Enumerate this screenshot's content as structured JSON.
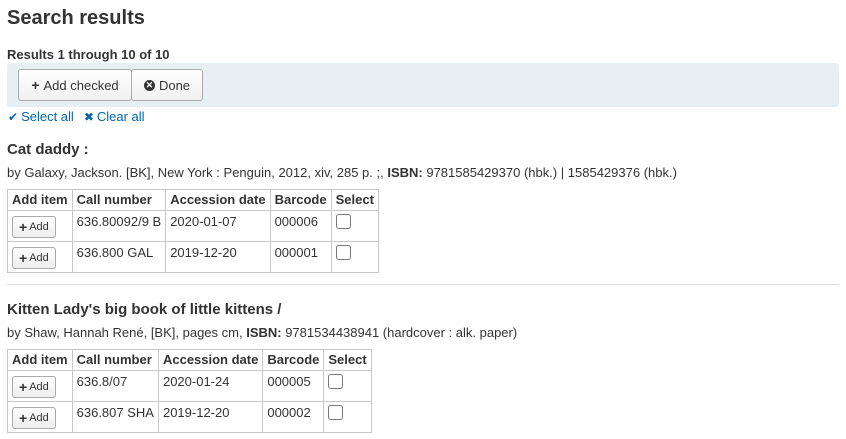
{
  "page": {
    "title": "Search results",
    "summary": "Results 1 through 10 of 10"
  },
  "toolbar": {
    "add_checked_label": "Add checked",
    "done_label": "Done"
  },
  "selection": {
    "select_all": "Select all",
    "clear_all": "Clear all"
  },
  "table_headers": {
    "add_item": "Add item",
    "call_number": "Call number",
    "accession_date": "Accession date",
    "barcode": "Barcode",
    "select": "Select"
  },
  "add_button_label": "Add",
  "records": [
    {
      "title": "Cat daddy :",
      "desc_prefix": "by Galaxy, Jackson. [BK], New York : Penguin, 2012, xiv, 285 p. ;, ",
      "isbn_label": "ISBN:",
      "isbn_value": " 9781585429370 (hbk.) | 1585429376 (hbk.)",
      "items": [
        {
          "call_number": "636.80092/9 B",
          "accession_date": "2020-01-07",
          "barcode": "000006",
          "checked": false
        },
        {
          "call_number": "636.800 GAL",
          "accession_date": "2019-12-20",
          "barcode": "000001",
          "checked": false
        }
      ]
    },
    {
      "title": "Kitten Lady's big book of little kittens /",
      "desc_prefix": "by Shaw, Hannah René, [BK], pages cm, ",
      "isbn_label": "ISBN:",
      "isbn_value": " 9781534438941 (hardcover : alk. paper)",
      "items": [
        {
          "call_number": "636.8/07",
          "accession_date": "2020-01-24",
          "barcode": "000005",
          "checked": false
        },
        {
          "call_number": "636.807 SHA",
          "accession_date": "2019-12-20",
          "barcode": "000002",
          "checked": false
        }
      ]
    }
  ]
}
